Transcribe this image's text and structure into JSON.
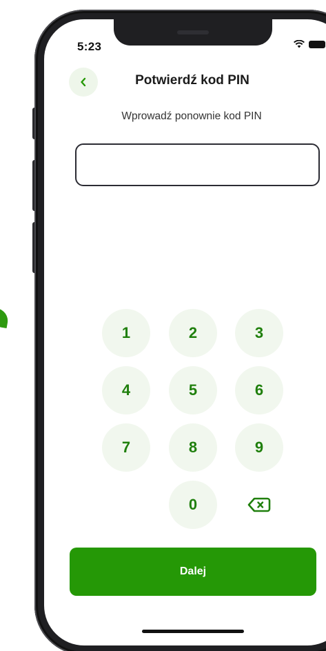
{
  "status_bar": {
    "time": "5:23",
    "wifi_icon": "wifi-icon",
    "battery_icon": "battery-icon"
  },
  "header": {
    "back_icon": "chevron-left-icon",
    "title": "Potwierdź kod PIN"
  },
  "prompt": "Wprowadź ponownie kod PIN",
  "pin_input": {
    "value": ""
  },
  "keypad": {
    "k1": "1",
    "k2": "2",
    "k3": "3",
    "k4": "4",
    "k5": "5",
    "k6": "6",
    "k7": "7",
    "k8": "8",
    "k9": "9",
    "k0": "0",
    "delete_icon": "backspace-icon"
  },
  "continue_button": {
    "label": "Dalej"
  },
  "colors": {
    "primary_green": "#259806",
    "key_background": "#f1f7ee",
    "key_text": "#1f7f0c"
  }
}
